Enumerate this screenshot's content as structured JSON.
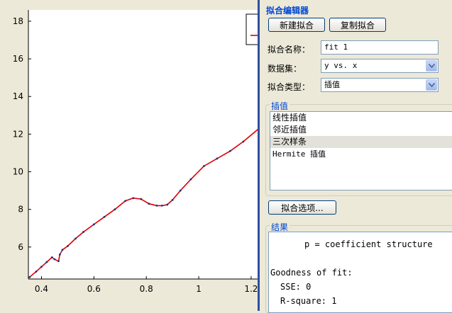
{
  "chart_data": {
    "type": "line",
    "xlim": [
      0.35,
      1.23
    ],
    "ylim": [
      4.3,
      18.6
    ],
    "x_ticks": [
      0.4,
      0.6,
      0.8,
      1,
      1.2
    ],
    "x_tick_labels": [
      "0.4",
      "0.6",
      "0.8",
      "1",
      "1.2"
    ],
    "y_ticks": [
      6,
      8,
      10,
      12,
      14,
      16,
      18
    ],
    "y_tick_labels": [
      "6",
      "8",
      "10",
      "12",
      "14",
      "16",
      "18"
    ],
    "grid": false,
    "legend": "top-right",
    "series": [
      {
        "color": "#dd0000",
        "x": [
          0.355,
          0.38,
          0.4,
          0.42,
          0.44,
          0.45,
          0.465,
          0.47,
          0.48,
          0.5,
          0.53,
          0.56,
          0.6,
          0.64,
          0.68,
          0.72,
          0.75,
          0.78,
          0.81,
          0.84,
          0.86,
          0.88,
          0.9,
          0.93,
          0.97,
          1.02,
          1.07,
          1.12,
          1.17,
          1.23
        ],
        "y": [
          4.4,
          4.7,
          4.95,
          5.2,
          5.45,
          5.35,
          5.25,
          5.6,
          5.85,
          6.05,
          6.45,
          6.8,
          7.2,
          7.6,
          8.0,
          8.45,
          8.6,
          8.55,
          8.3,
          8.2,
          8.2,
          8.25,
          8.5,
          9.0,
          9.6,
          10.3,
          10.7,
          11.1,
          11.6,
          12.3
        ]
      }
    ]
  },
  "panel": {
    "editor_title": "拟合编辑器",
    "new_fit_button": "新建拟合",
    "copy_fit_button": "复制拟合",
    "fit_name_label": "拟合名称：",
    "fit_name_value": "fit 1",
    "dataset_label": "数据集：",
    "dataset_value": "y vs. x",
    "fit_type_label": "拟合类型：",
    "fit_type_value": "插值",
    "interp_title": "插值",
    "interp_items": [
      "线性插值",
      "邻近插值",
      "三次样条",
      "Hermite 插值"
    ],
    "fit_options_button": "拟合选项...",
    "results_title": "结果",
    "results_lines": [
      "p = coefficient structure",
      "Goodness of fit:",
      "SSE: 0",
      "R-square: 1"
    ],
    "colors": {
      "accent": "#0046d5",
      "divider": "#2f4fa0",
      "curve": "#dd0000"
    }
  }
}
